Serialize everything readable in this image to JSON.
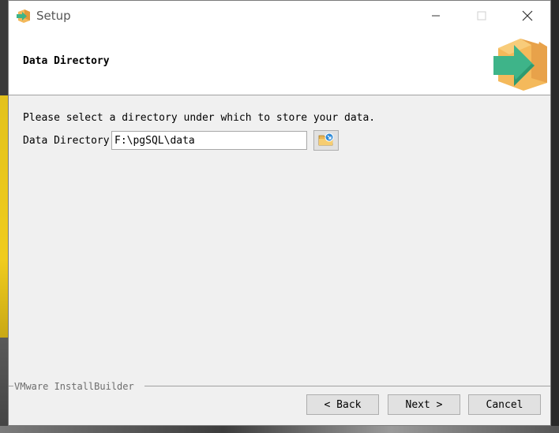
{
  "window": {
    "title": "Setup",
    "controls": {
      "minimize": "minimize-icon",
      "maximize": "maximize-icon",
      "close": "close-icon"
    }
  },
  "header": {
    "title": "Data Directory",
    "logo": "installer-box-arrow-icon"
  },
  "content": {
    "instruction": "Please select a directory under which to store your data.",
    "data_directory": {
      "label": "Data Directory",
      "value": "F:\\pgSQL\\data",
      "browse_icon": "folder-browse-icon"
    }
  },
  "footer": {
    "brand": "VMware InstallBuilder",
    "buttons": {
      "back": "< Back",
      "next": "Next >",
      "cancel": "Cancel"
    }
  },
  "colors": {
    "window_bg": "#f0f0f0",
    "header_bg": "#ffffff",
    "logo_box": "#f4b95b",
    "logo_arrow": "#3eb489"
  }
}
